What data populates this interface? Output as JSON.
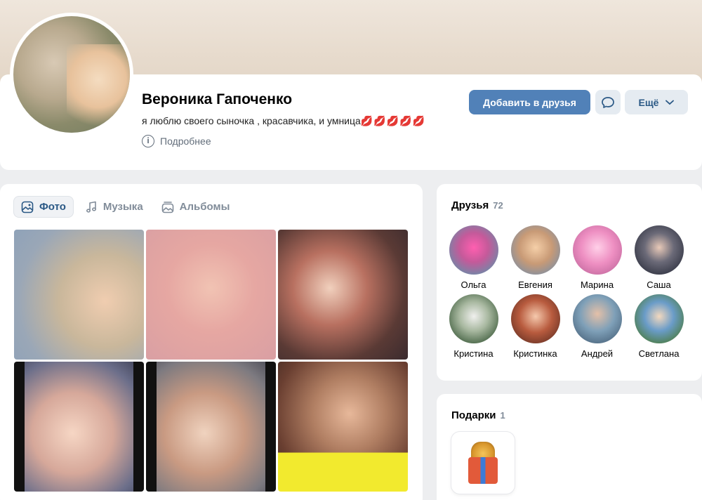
{
  "profile": {
    "name": "Вероника Гапоченко",
    "status_text": "я люблю своего сыночка , красавчика, и умница",
    "status_emoji": "💋💋💋💋💋",
    "details_label": "Подробнее",
    "add_friend_label": "Добавить в друзья",
    "more_label": "Ещё"
  },
  "photos": {
    "tabs": [
      {
        "label": "Фото",
        "icon": "photo-icon",
        "active": true
      },
      {
        "label": "Музыка",
        "icon": "music-icon",
        "active": false
      },
      {
        "label": "Альбомы",
        "icon": "albums-icon",
        "active": false
      }
    ],
    "count_thumbnails": 6
  },
  "friends": {
    "title": "Друзья",
    "count": "72",
    "items": [
      {
        "name": "Ольга"
      },
      {
        "name": "Евгения"
      },
      {
        "name": "Марина"
      },
      {
        "name": "Саша"
      },
      {
        "name": "Кристина"
      },
      {
        "name": "Кристинка"
      },
      {
        "name": "Андрей"
      },
      {
        "name": "Светлана"
      }
    ]
  },
  "gifts": {
    "title": "Подарки",
    "count": "1"
  },
  "colors": {
    "accent": "#5181b8",
    "link": "#2a5885",
    "secondary": "#818c99",
    "page_bg": "#edeef0"
  }
}
